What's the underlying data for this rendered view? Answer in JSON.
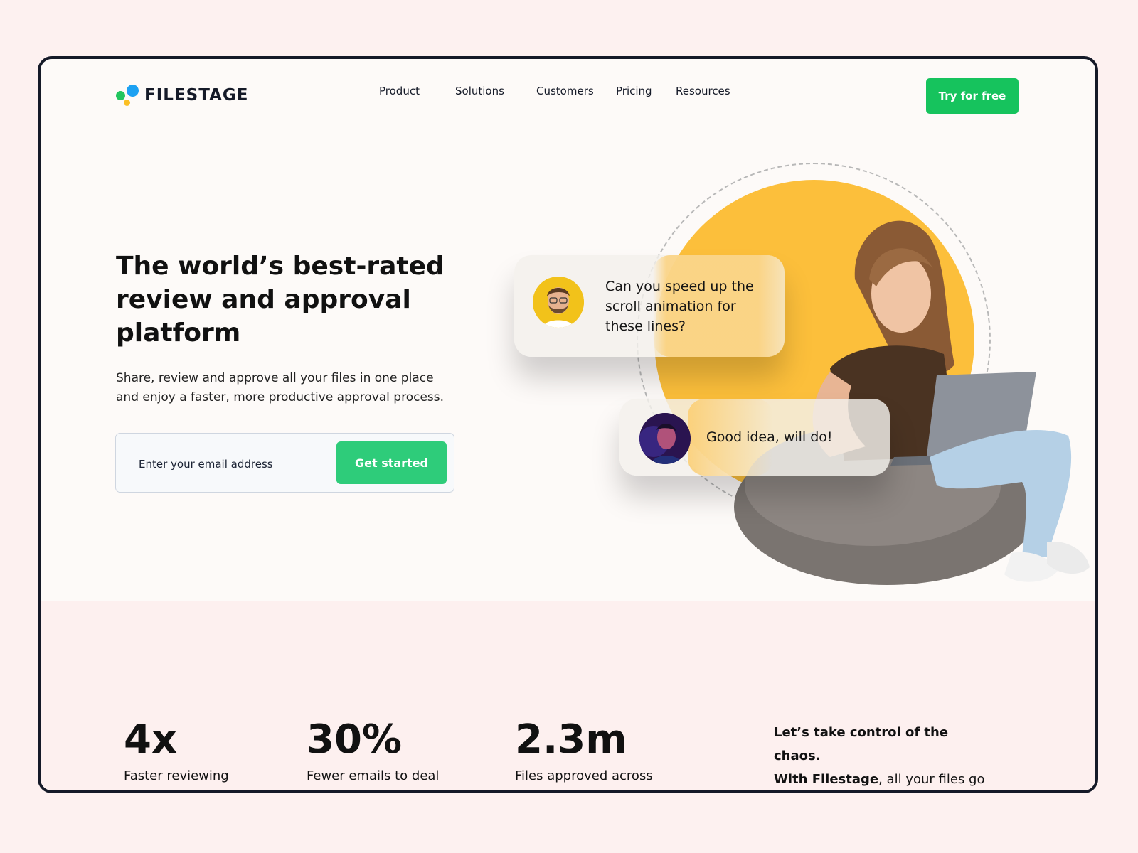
{
  "brand": {
    "name": "FILESTAGE"
  },
  "nav": {
    "items": [
      "Product",
      "Solutions",
      "Customers",
      "Pricing",
      "Resources"
    ],
    "cta": "Try for free"
  },
  "hero": {
    "title": "The world’s best-rated review and approval platform",
    "subtitle": "Share, review and approve all your files in one place and enjoy a faster, more productive approval process.",
    "email_placeholder": "Enter your email address",
    "cta": "Get started"
  },
  "chat": {
    "message_1": "Can you speed up the scroll animation for these lines?",
    "message_2": "Good idea, will do!"
  },
  "stats": [
    {
      "value": "4x",
      "label": "Faster reviewing"
    },
    {
      "value": "30%",
      "label": "Fewer emails to deal"
    },
    {
      "value": "2.3m",
      "label": "Files approved across"
    }
  ],
  "chaos": {
    "line1": "Let’s take control of the chaos.",
    "brand_bold": "With Filestage",
    "rest": ", all your files go through a structured and"
  },
  "colors": {
    "accent_green": "#16c35d",
    "button_green": "#2ecc7a",
    "yellow": "#fcbf3b",
    "dark": "#151a28",
    "page_bg": "#fdf1f0"
  }
}
